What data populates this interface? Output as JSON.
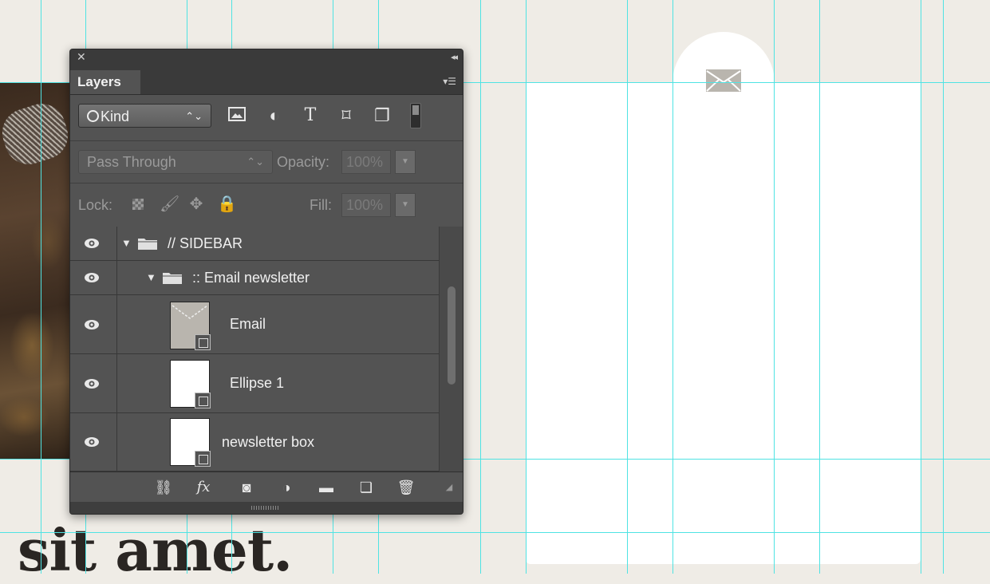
{
  "canvas": {
    "heading_text": "sit amet.",
    "guide_color": "#4fe3e3"
  },
  "panel": {
    "tab_label": "Layers",
    "filter": {
      "kind_label": "Kind",
      "icons": [
        "image-filter-icon",
        "adjustment-filter-icon",
        "type-filter-icon",
        "shape-filter-icon",
        "smart-object-filter-icon"
      ]
    },
    "blend": {
      "mode": "Pass Through",
      "opacity_label": "Opacity:",
      "opacity_value": "100%"
    },
    "lock": {
      "label": "Lock:",
      "fill_label": "Fill:",
      "fill_value": "100%"
    },
    "layers": [
      {
        "name": "// SIDEBAR",
        "type": "group"
      },
      {
        "name": ":: Email newsletter",
        "type": "group"
      },
      {
        "name": "Email",
        "type": "shape"
      },
      {
        "name": "Ellipse 1",
        "type": "shape"
      },
      {
        "name": "newsletter box",
        "type": "shape"
      }
    ]
  }
}
